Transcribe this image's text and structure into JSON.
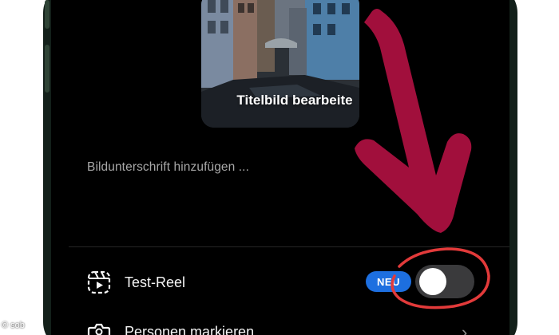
{
  "cover": {
    "edit_label": "Titelbild bearbeite",
    "icon": "canal-photo"
  },
  "caption": {
    "placeholder": "Bildunterschrift hinzufügen ..."
  },
  "options": {
    "test_reel": {
      "label": "Test-Reel",
      "icon": "reels-icon",
      "badge": "NEU",
      "toggle_on": false
    },
    "tag_people": {
      "label": "Personen markieren",
      "icon": "tag-person-icon"
    }
  },
  "annotation": {
    "color": "#a10f3c",
    "shapes": [
      "arrow",
      "circle"
    ]
  },
  "credit": "© sob",
  "colors": {
    "background": "#000000",
    "badge": "#1d6fe0",
    "toggle_off": "#3a3a3c",
    "frame": "#13201a"
  }
}
